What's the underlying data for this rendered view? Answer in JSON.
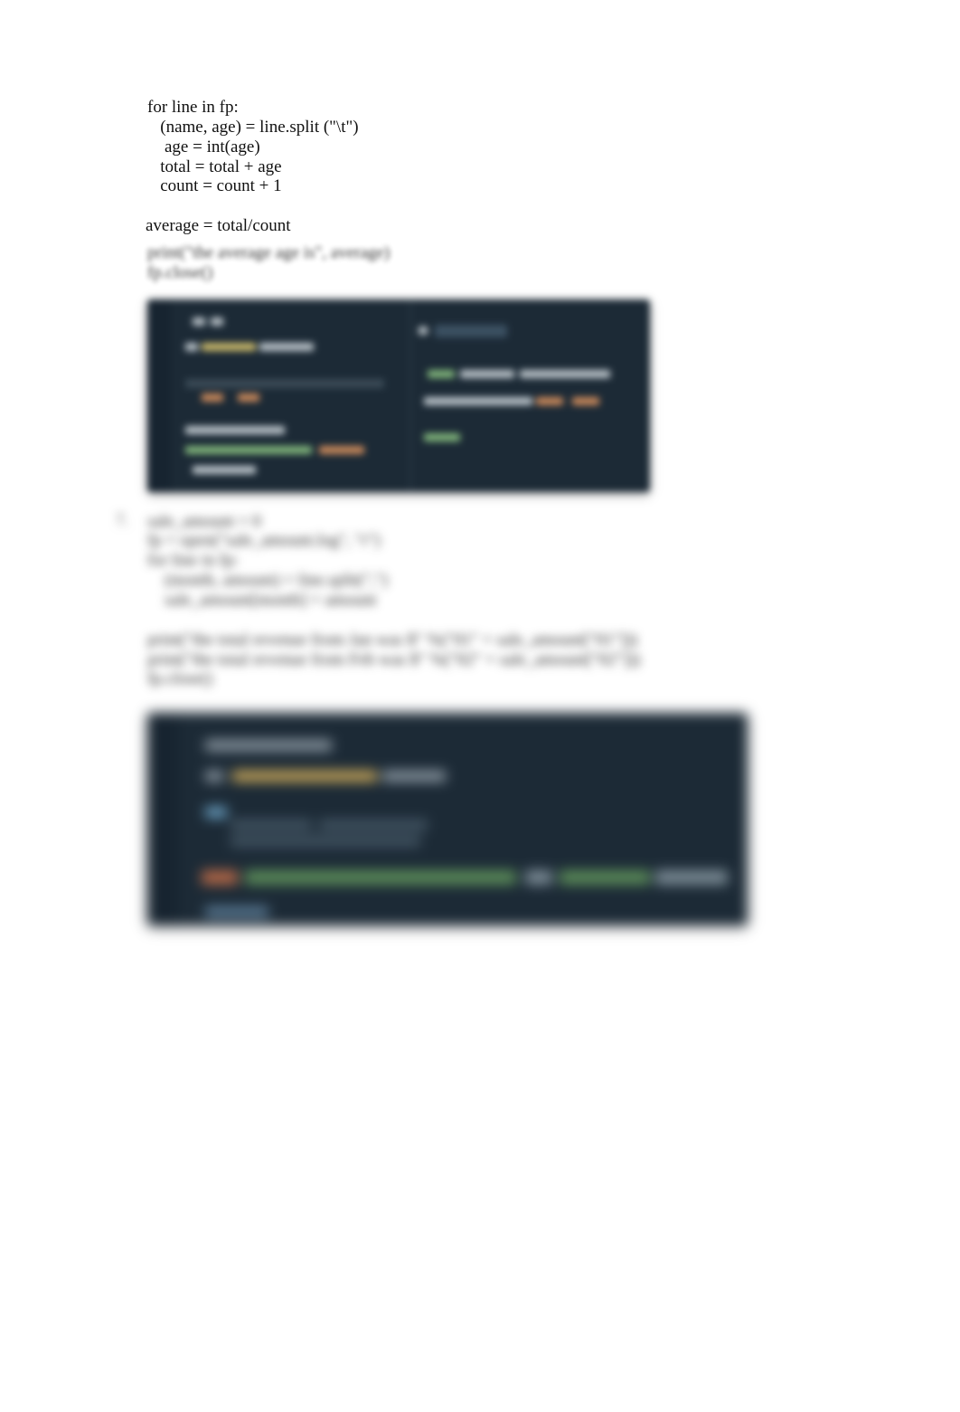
{
  "code1": {
    "l1": "for line in fp:",
    "l2": "   (name, age) = line.split (\"\\t\")",
    "l3": "    age = int(age)",
    "l4": "   total = total + age",
    "l5": "   count = count + 1",
    "l6": "",
    "l7": "average = total/count",
    "l8": "print(\"the average age is\", average)",
    "l9": "fp.close()"
  },
  "middle_marker": "7.",
  "middle": {
    "m1": "sale_amount = 0",
    "m2": "fp = open(\"sale_amount.log\", \"r\")",
    "m3": "for line in fp:",
    "m4": "    (month, amount) = line.split(\",\")",
    "m5": "    sale_amount[month] = amount",
    "m6": "",
    "m7": "print(\"the total revenue from Jan was $\" %(\"01\" + sale_amount[\"01\"]))",
    "m8": "print(\"the total revenue from Feb was $\" %(\"02\" + sale_amount[\"02\"]))",
    "m9": "fp.close()"
  }
}
